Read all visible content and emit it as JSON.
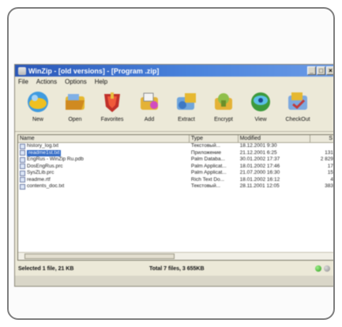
{
  "window": {
    "title": "WinZip - [old versions] - [Program .zip]"
  },
  "menu": [
    "File",
    "Actions",
    "Options",
    "Help"
  ],
  "toolbar": [
    {
      "label": "New",
      "icon": "new-archive-icon"
    },
    {
      "label": "Open",
      "icon": "open-archive-icon"
    },
    {
      "label": "Favorites",
      "icon": "favorites-icon"
    },
    {
      "label": "Add",
      "icon": "add-files-icon"
    },
    {
      "label": "Extract",
      "icon": "extract-icon"
    },
    {
      "label": "Encrypt",
      "icon": "encrypt-icon"
    },
    {
      "label": "View",
      "icon": "view-icon"
    },
    {
      "label": "CheckOut",
      "icon": "checkout-icon"
    }
  ],
  "columns": {
    "name": "Name",
    "type": "Type",
    "modified": "Modified",
    "size": "S"
  },
  "files": [
    {
      "name": "history_log.txt",
      "type": "Текстовый...",
      "modified": "18.12.2001 9:30",
      "size": "",
      "selected": false
    },
    {
      "name": "readme1st.txt",
      "type": "Приложение",
      "modified": "21.12.2001 6:25",
      "size": "131",
      "selected": true
    },
    {
      "name": "EngRus - WinZip Ru.pdb",
      "type": "Palm Databa...",
      "modified": "30.01.2002 17:37",
      "size": "2 829",
      "selected": false
    },
    {
      "name": "DosEngRus.prc",
      "type": "Palm Applicat...",
      "modified": "18.01.2002 17:46",
      "size": "17",
      "selected": false
    },
    {
      "name": "SysZLib.prc",
      "type": "Palm Applicat...",
      "modified": "21.07.2000 16:30",
      "size": "15",
      "selected": false
    },
    {
      "name": "readme.rtf",
      "type": "Rich Text Do...",
      "modified": "18.01.2002 16:12",
      "size": "4",
      "selected": false
    },
    {
      "name": "contents_doc.txt",
      "type": "Текстовый...",
      "modified": "28.11.2001 12:05",
      "size": "383",
      "selected": false
    }
  ],
  "status": {
    "selected": "Selected 1 file, 21 KB",
    "total": "Total 7 files, 3 655KB"
  },
  "colors": {
    "titlebar": "#2a57b8",
    "selection": "#316ac5",
    "window_face": "#ece9d8"
  }
}
